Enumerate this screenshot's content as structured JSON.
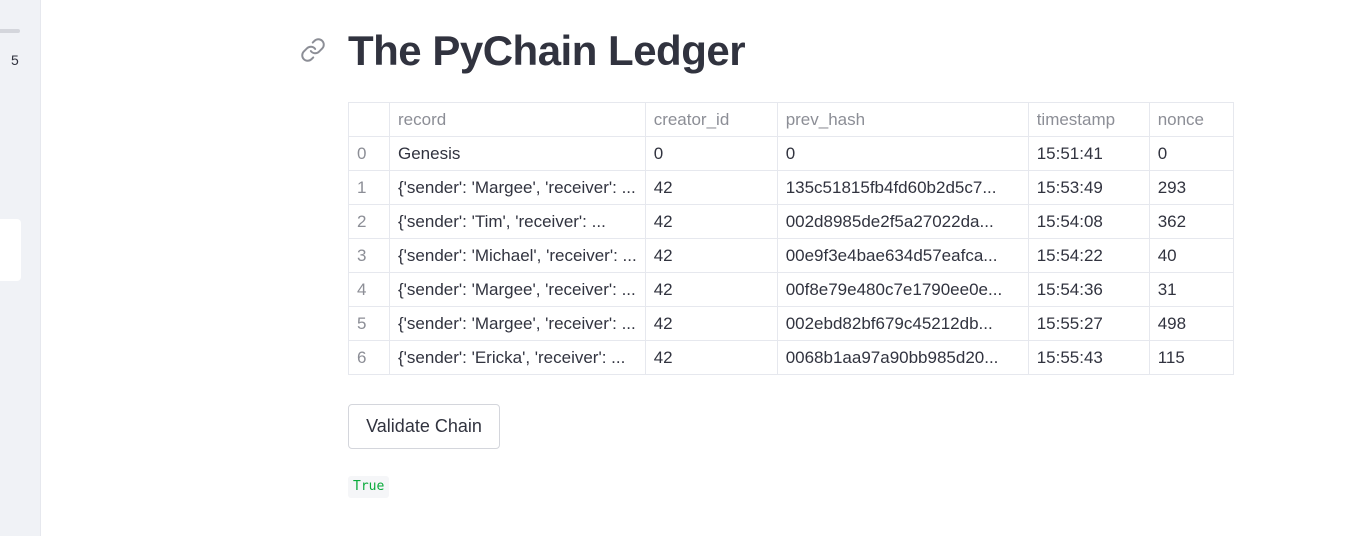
{
  "sidebar": {
    "slider_value": "5"
  },
  "page": {
    "title": "The PyChain Ledger"
  },
  "icons": {
    "anchor": "link-icon"
  },
  "table": {
    "columns": [
      "",
      "record",
      "creator_id",
      "prev_hash",
      "timestamp",
      "nonce"
    ],
    "rows": [
      [
        "0",
        "Genesis",
        "0",
        "0",
        "15:51:41",
        "0"
      ],
      [
        "1",
        "{'sender': 'Margee', 'receiver': ...",
        "42",
        "135c51815fb4fd60b2d5c7...",
        "15:53:49",
        "293"
      ],
      [
        "2",
        "{'sender': 'Tim', 'receiver': ...",
        "42",
        "002d8985de2f5a27022da...",
        "15:54:08",
        "362"
      ],
      [
        "3",
        "{'sender': 'Michael', 'receiver': ...",
        "42",
        "00e9f3e4bae634d57eafca...",
        "15:54:22",
        "40"
      ],
      [
        "4",
        "{'sender': 'Margee', 'receiver': ...",
        "42",
        "00f8e79e480c7e1790ee0e...",
        "15:54:36",
        "31"
      ],
      [
        "5",
        "{'sender': 'Margee', 'receiver': ...",
        "42",
        "002ebd82bf679c45212db...",
        "15:55:27",
        "498"
      ],
      [
        "6",
        "{'sender': 'Ericka', 'receiver': ...",
        "42",
        "0068b1aa97a90bb985d20...",
        "15:55:43",
        "115"
      ]
    ]
  },
  "actions": {
    "validate_label": "Validate Chain"
  },
  "result": {
    "value": "True"
  },
  "colors": {
    "text": "#31333f",
    "muted": "#8c8e96",
    "success": "#09ab3b",
    "sidebar_bg": "#f0f2f6"
  }
}
